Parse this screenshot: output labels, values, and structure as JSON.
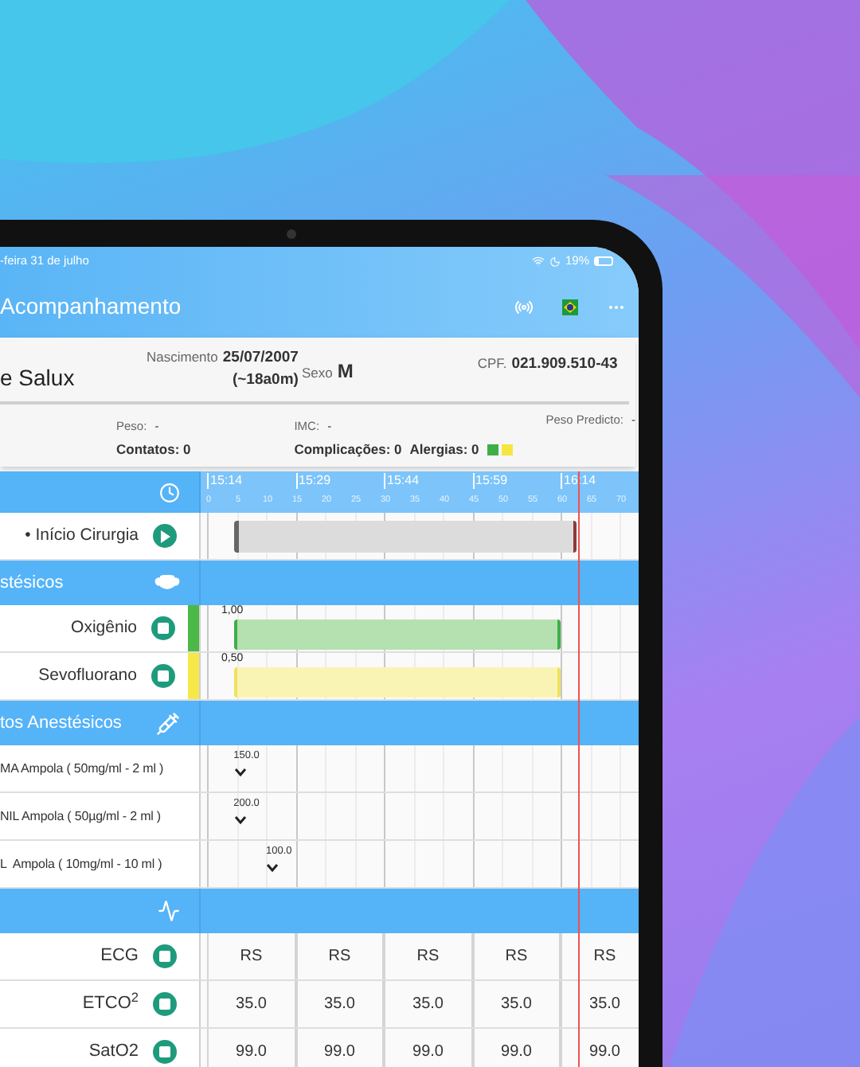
{
  "status_bar": {
    "date": "-feira 31 de julho",
    "battery": "19%"
  },
  "nav": {
    "title": "Acompanhamento"
  },
  "patient": {
    "name": "e Salux",
    "birth_label": "Nascimento",
    "birth_date": "25/07/2007",
    "age": "(~18a0m)",
    "sex_label": "Sexo",
    "sex": "M",
    "cpf_label": "CPF.",
    "cpf": "021.909.510-43",
    "weight_label": "Peso:",
    "weight": "-",
    "contacts": "Contatos: 0",
    "bmi_label": "IMC:",
    "bmi": "-",
    "complications": "Complicações: 0",
    "allergies": "Alergias: 0",
    "predicted_label": "Peso Predicto:",
    "predicted": "-",
    "tags": [
      {
        "color": "#3fae49"
      },
      {
        "color": "#f5e642"
      }
    ]
  },
  "timeline": {
    "times": [
      "15:14",
      "15:29",
      "15:44",
      "15:59",
      "16:14"
    ],
    "minutes": [
      "0",
      "5",
      "10",
      "15",
      "20",
      "25",
      "30",
      "35",
      "40",
      "45",
      "50",
      "55",
      "60",
      "65",
      "70"
    ]
  },
  "rows": [
    {
      "kind": "event",
      "label": "• Início Cirurgia"
    },
    {
      "kind": "section",
      "label": "stésicos"
    },
    {
      "kind": "gas",
      "label": "Oxigênio",
      "color": "#4cb848",
      "value": "1,00"
    },
    {
      "kind": "gas",
      "label": "Sevofluorano",
      "color": "#f7e84a",
      "value": "0,50"
    },
    {
      "kind": "section",
      "label": "tos Anestésicos"
    },
    {
      "kind": "drug",
      "label": "MA Ampola ( 50mg/ml - 2 ml )",
      "value": "150.0"
    },
    {
      "kind": "drug",
      "label": "NIL Ampola ( 50µg/ml - 2 ml )",
      "value": "200.0"
    },
    {
      "kind": "drug",
      "label": "L  Ampola ( 10mg/ml - 10 ml )",
      "value": "100.0"
    },
    {
      "kind": "section"
    },
    {
      "kind": "vital",
      "label": "ECG",
      "values": [
        "RS",
        "RS",
        "RS",
        "RS",
        "RS"
      ]
    },
    {
      "kind": "vital",
      "label": "ETCO$^{2}$",
      "values": [
        "35.0",
        "35.0",
        "35.0",
        "35.0",
        "35.0"
      ]
    },
    {
      "kind": "vital",
      "label": "SatO2",
      "values": [
        "99.0",
        "99.0",
        "99.0",
        "99.0",
        "99.0"
      ]
    }
  ]
}
